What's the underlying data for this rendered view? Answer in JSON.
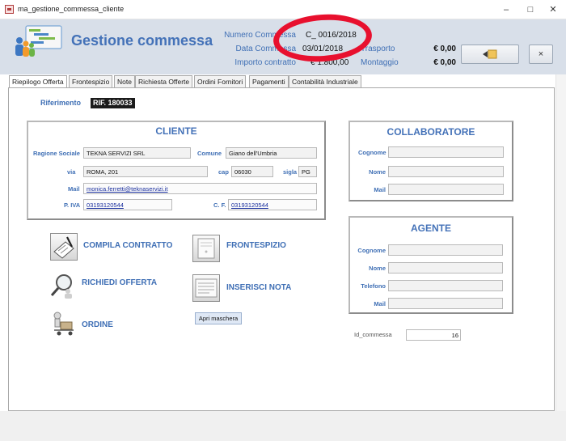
{
  "window": {
    "title": "ma_gestione_commessa_cliente",
    "controls": {
      "minimize": "–",
      "maximize": "□",
      "close": "✕"
    }
  },
  "header": {
    "title": "Gestione commessa",
    "numero_commessa": {
      "label": "Numero Commessa",
      "value": "C_ 0016/2018"
    },
    "data_commessa": {
      "label": "Data Commessa",
      "value": "03/01/2018"
    },
    "importo_contratto": {
      "label": "Importo contratto",
      "value": "€ 1.800,00"
    },
    "trasporto": {
      "label": "Trasporto",
      "value": "€ 0,00"
    },
    "montaggio": {
      "label": "Montaggio",
      "value": "€ 0,00"
    },
    "back_icon": "arrow-back-icon",
    "close_button": "×",
    "annotation_color": "#e8102e"
  },
  "tabs": [
    "Riepilogo Offerta",
    "Frontespizio",
    "Note",
    "Richiesta Offerte",
    "Ordini Fornitori",
    "Pagamenti",
    "Contabilità Industriale"
  ],
  "riferimento": {
    "label": "Riferimento",
    "value": "RIF. 180033"
  },
  "cliente": {
    "title": "CLIENTE",
    "ragione_sociale": {
      "label": "Ragione Sociale",
      "value": "TEKNA SERVIZI SRL"
    },
    "comune": {
      "label": "Comune",
      "value": "Giano dell'Umbria"
    },
    "via": {
      "label": "via",
      "value": "ROMA, 201"
    },
    "cap": {
      "label": "cap",
      "value": "06030"
    },
    "sigla": {
      "label": "sigla",
      "value": "PG"
    },
    "mail": {
      "label": "Mail",
      "value": "monica.ferretti@teknaservizi.it"
    },
    "piva": {
      "label": "P. IVA",
      "value": "03193120544"
    },
    "cf": {
      "label": "C. F.",
      "value": "03193120544"
    }
  },
  "collaboratore": {
    "title": "COLLABORATORE",
    "fields": [
      {
        "label": "Cognome",
        "value": ""
      },
      {
        "label": "Nome",
        "value": ""
      },
      {
        "label": "Mail",
        "value": ""
      }
    ]
  },
  "agente": {
    "title": "AGENTE",
    "fields": [
      {
        "label": "Cognome",
        "value": ""
      },
      {
        "label": "Nome",
        "value": ""
      },
      {
        "label": "Telefono",
        "value": ""
      },
      {
        "label": "Mail",
        "value": ""
      }
    ]
  },
  "actions": {
    "compila_contratto": "COMPILA CONTRATTO",
    "richiedi_offerta": "RICHIEDI OFFERTA",
    "ordine": "ORDINE",
    "frontespizio": "FRONTESPIZIO",
    "inserisci_nota": "INSERISCI NOTA",
    "apri_maschera": "Apri maschera"
  },
  "id_commessa": {
    "label": "Id_commessa",
    "value": "16"
  },
  "icons": {
    "compila": "contract-pen-icon",
    "richiedi": "magnifier-person-icon",
    "ordine": "delivery-cart-icon",
    "frontespizio": "document-page-icon",
    "nota": "note-list-icon"
  }
}
